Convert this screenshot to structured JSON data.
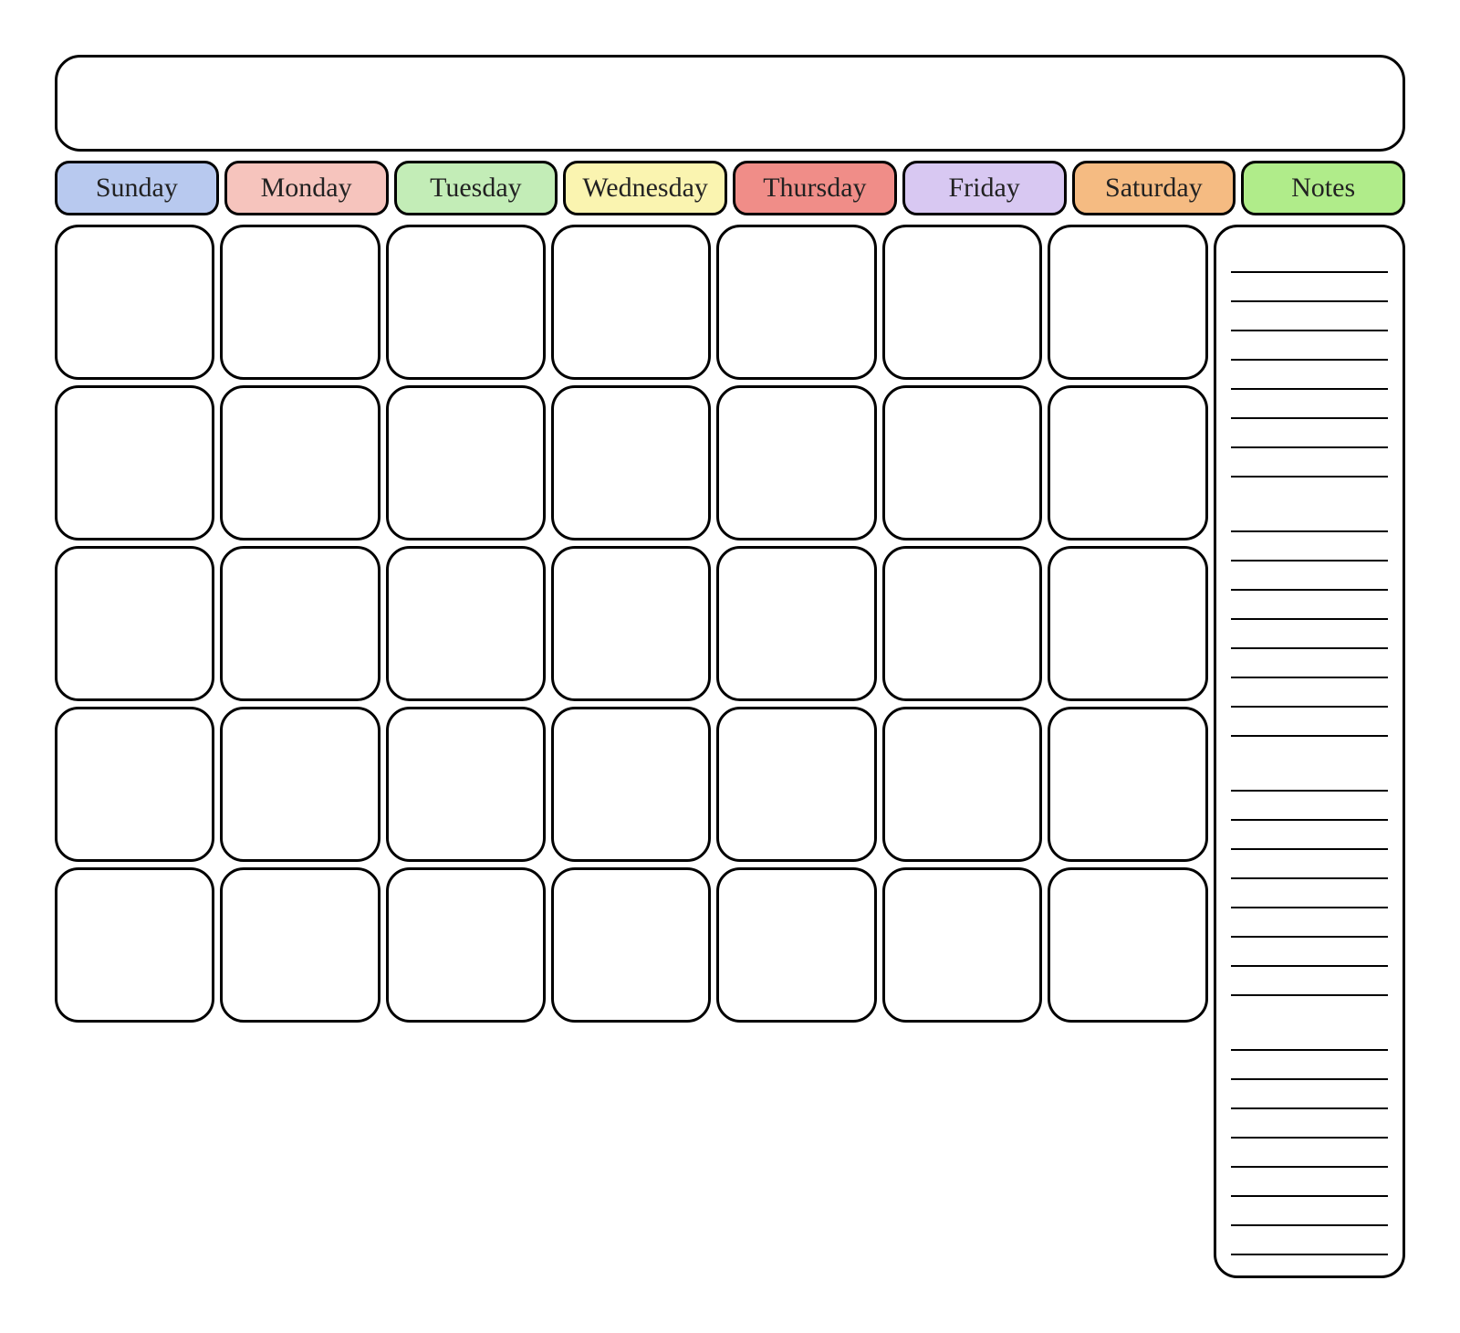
{
  "title": "",
  "days": [
    {
      "label": "Sunday",
      "color": "#b8c9ef"
    },
    {
      "label": "Monday",
      "color": "#f6c4bd"
    },
    {
      "label": "Tuesday",
      "color": "#c3edb7"
    },
    {
      "label": "Wednesday",
      "color": "#faf4b0"
    },
    {
      "label": "Thursday",
      "color": "#f08d88"
    },
    {
      "label": "Friday",
      "color": "#d8c8f2"
    },
    {
      "label": "Saturday",
      "color": "#f5bb82"
    }
  ],
  "notes_header": {
    "label": "Notes",
    "color": "#b0ec8a"
  },
  "grid": {
    "rows": 5,
    "cols": 7
  },
  "notes_line_groups": [
    8,
    8,
    8,
    8
  ]
}
